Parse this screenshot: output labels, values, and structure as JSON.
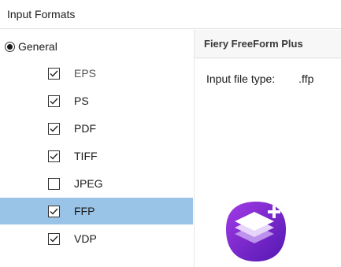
{
  "section": {
    "title": "Input Formats"
  },
  "radio": {
    "label": "General",
    "selected": true
  },
  "formats": [
    {
      "label": "EPS",
      "checked": true,
      "selected": false,
      "dim": true
    },
    {
      "label": "PS",
      "checked": true,
      "selected": false,
      "dim": false
    },
    {
      "label": "PDF",
      "checked": true,
      "selected": false,
      "dim": false
    },
    {
      "label": "TIFF",
      "checked": true,
      "selected": false,
      "dim": false
    },
    {
      "label": "JPEG",
      "checked": false,
      "selected": false,
      "dim": false
    },
    {
      "label": "FFP",
      "checked": true,
      "selected": true,
      "dim": false
    },
    {
      "label": "VDP",
      "checked": true,
      "selected": false,
      "dim": false
    }
  ],
  "details": {
    "title": "Fiery FreeForm Plus",
    "property_label": "Input file type:",
    "property_value": ".ffp",
    "icon": "stacked-layers-plus-icon"
  },
  "colors": {
    "selection": "#99c4e8",
    "icon_gradient_start": "#9b2fe0",
    "icon_gradient_end": "#5a1bb5"
  }
}
